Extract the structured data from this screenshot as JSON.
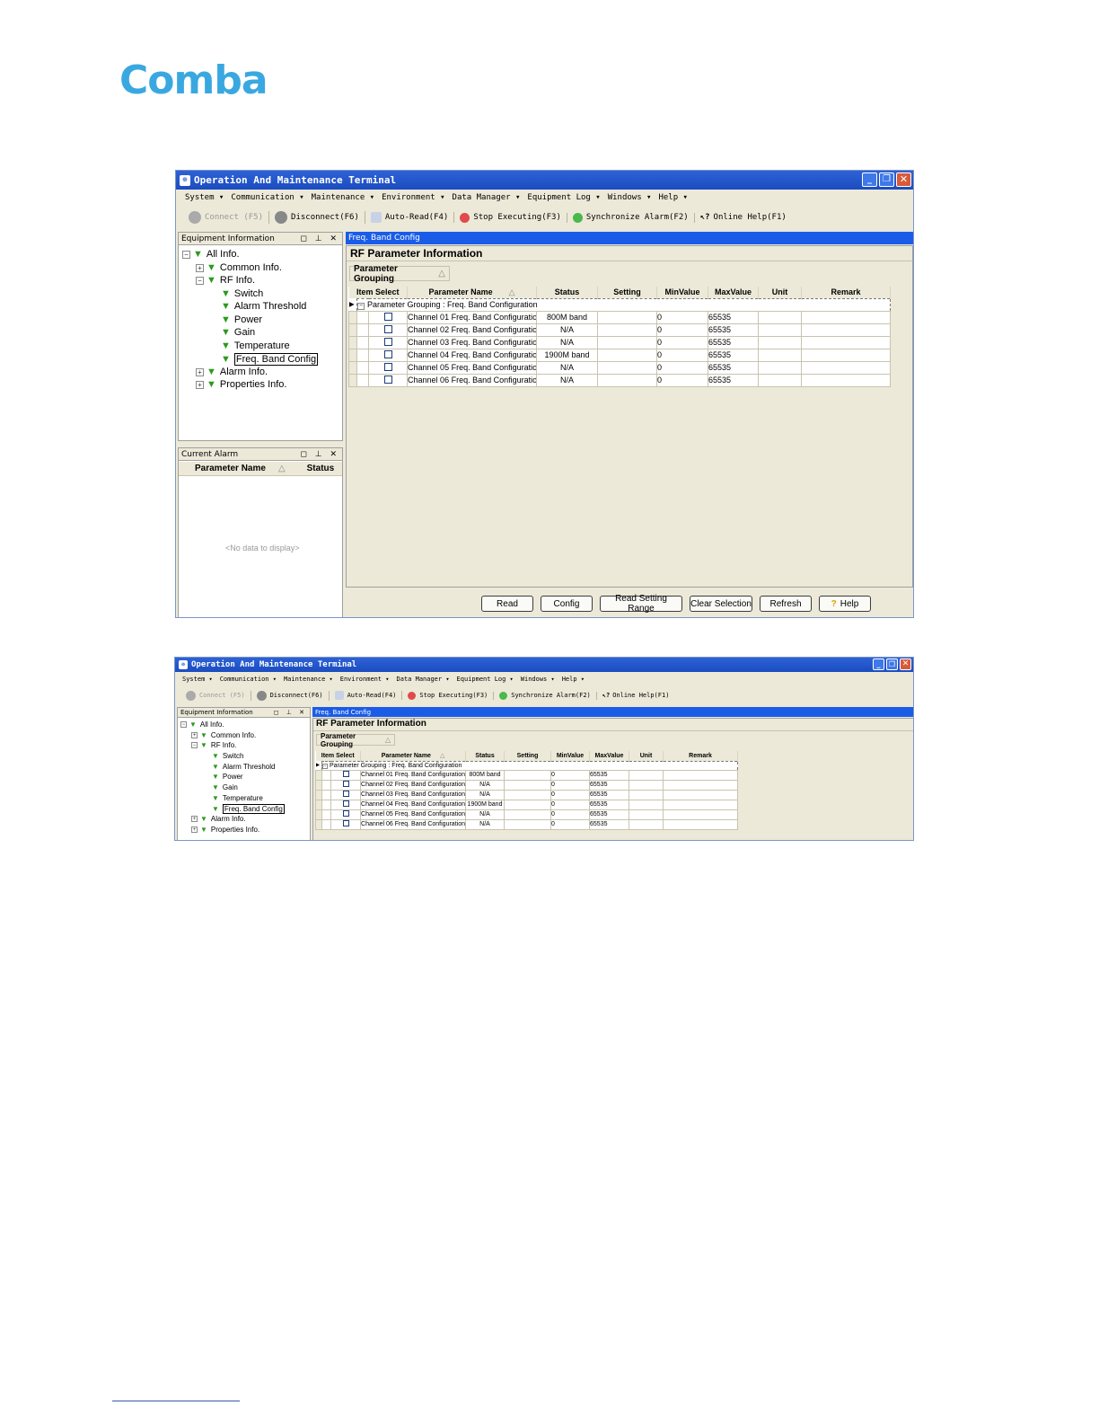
{
  "brand": {
    "logo_text": "Comba",
    "logo_color": "#3aa8e0"
  },
  "window": {
    "title": "Operation And Maintenance Terminal",
    "menu": [
      "System ▾",
      "Communication ▾",
      "Maintenance ▾",
      "Environment ▾",
      "Data Manager ▾",
      "Equipment Log ▾",
      "Windows ▾",
      "Help ▾"
    ],
    "toolbar": {
      "connect": "Connect (F5)",
      "disconnect": "Disconnect(F6)",
      "auto_read": "Auto-Read(F4)",
      "stop": "Stop Executing(F3)",
      "sync": "Synchronize Alarm(F2)",
      "help": "Online Help(F1)"
    }
  },
  "equipment_panel": {
    "title": "Equipment Information",
    "tree": {
      "root": "All Info.",
      "common": "Common Info.",
      "rf": "RF Info.",
      "switch": "Switch",
      "alarm_threshold": "Alarm Threshold",
      "power": "Power",
      "gain": "Gain",
      "temperature": "Temperature",
      "freq": "Freq. Band Config",
      "alarm": "Alarm Info.",
      "properties": "Properties Info."
    }
  },
  "alarm_panel": {
    "title": "Current Alarm",
    "col_name": "Parameter Name",
    "col_status": "Status",
    "empty": "<No data to display>"
  },
  "tab": {
    "label": "Freq. Band Config"
  },
  "rf_section": {
    "title": "RF Parameter Information",
    "grouping": "Parameter Grouping",
    "group_row": "Parameter Grouping : Freq. Band Configuration",
    "group_row_small": "Parameter Grouping : Freq. Band Configuration",
    "columns": {
      "item_select": "Item Select",
      "name": "Parameter Name",
      "status": "Status",
      "setting": "Setting",
      "min": "MinValue",
      "max": "MaxValue",
      "unit": "Unit",
      "remark": "Remark"
    },
    "rows": [
      {
        "name": "Channel 01 Freq. Band Configuration",
        "status": "800M band",
        "min": "0",
        "max": "65535"
      },
      {
        "name": "Channel 02 Freq. Band Configuration",
        "status": "N/A",
        "min": "0",
        "max": "65535"
      },
      {
        "name": "Channel 03 Freq. Band Configuration",
        "status": "N/A",
        "min": "0",
        "max": "65535"
      },
      {
        "name": "Channel 04 Freq. Band Configuration",
        "status": "1900M band",
        "min": "0",
        "max": "65535"
      },
      {
        "name": "Channel 05 Freq. Band Configuration",
        "status": "N/A",
        "min": "0",
        "max": "65535"
      },
      {
        "name": "Channel 06 Freq. Band Configuration",
        "status": "N/A",
        "min": "0",
        "max": "65535"
      }
    ]
  },
  "buttons": {
    "read": "Read",
    "config": "Config",
    "read_range": "Read Setting Range",
    "clear": "Clear Selection",
    "refresh": "Refresh",
    "help": "Help"
  }
}
